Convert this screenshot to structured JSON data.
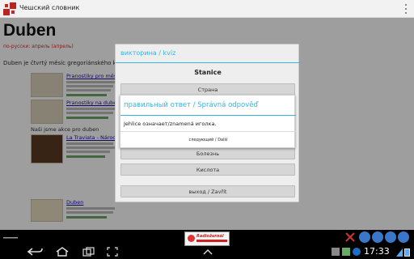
{
  "actionbar": {
    "title": "Чешский словник"
  },
  "page": {
    "heading": "Duben",
    "translation": "по-русски: апрель (апрель)",
    "description": "Duben je čtvrtý měsíc gregoriánského kalendáře",
    "results": [
      {
        "title": "Pranostiky pro měsíc"
      },
      {
        "title": "Pranostiky na duben"
      },
      {
        "title": "La Traviata - Národní"
      },
      {
        "title": "Duben"
      }
    ],
    "subheading": "Naši jsme akce pro duben"
  },
  "quiz": {
    "title": "викторина / kvíz",
    "question": "Stanice",
    "options": [
      "Страна",
      "",
      "",
      "Болезнь",
      "Кислота"
    ],
    "exit_label": "выход / Zavřít"
  },
  "answer_dialog": {
    "title": "правильный ответ / Správná odpověď",
    "message": "Jehlice означает/znamená иголка.",
    "next_label": "следующий / Další"
  },
  "statusbar": {
    "clock": "17:33",
    "ad_text": "Radiožurnál"
  },
  "colors": {
    "accent": "#33b5e5",
    "statusbar": "#000000",
    "heading_red": "#cc3333",
    "link_blue": "#1a0dab"
  },
  "icons": {
    "app": "czech-flag-emblem-icon",
    "overflow": "overflow-menu-icon",
    "nav_back": "back-arrow-icon",
    "nav_home": "home-icon",
    "nav_recent": "recent-apps-icon",
    "nav_screenshot": "screenshot-icon",
    "menu_up": "chevron-up-icon"
  }
}
